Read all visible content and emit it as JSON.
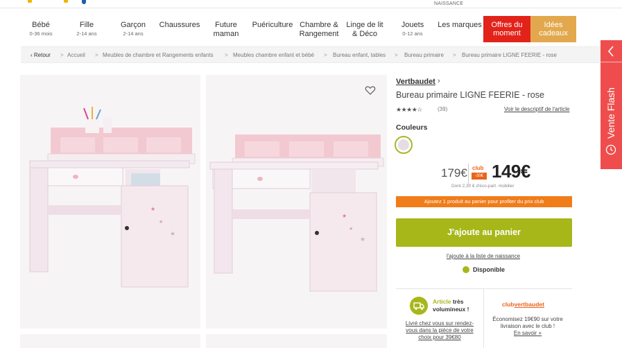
{
  "top": {
    "naissance_text": "NAISSANCE"
  },
  "nav": {
    "items": [
      {
        "label": "Bébé",
        "sub": "0-36 mois"
      },
      {
        "label": "Fille",
        "sub": "2-14 ans"
      },
      {
        "label": "Garçon",
        "sub": "2-14 ans"
      },
      {
        "label": "Chaussures",
        "sub": ""
      },
      {
        "label": "Future maman",
        "sub": ""
      },
      {
        "label": "Puériculture",
        "sub": ""
      },
      {
        "label": "Chambre & Rangement",
        "sub": ""
      },
      {
        "label": "Linge de lit & Déco",
        "sub": ""
      },
      {
        "label": "Jouets",
        "sub": "0-12 ans"
      },
      {
        "label": "Les marques",
        "sub": ""
      }
    ],
    "offres": "Offres du moment",
    "idees": "Idées cadeaux",
    "offres_color": "#e2231a",
    "idees_color": "#e3a84d"
  },
  "breadcrumb": {
    "back": "Retour",
    "items": [
      "Accueil",
      "Meubles de chambre et Rangements enfants",
      "Meubles chambre enfant et bébé",
      "Bureau enfant, tables",
      "Bureau primaire",
      "Bureau primaire LIGNE FEERIE - rose"
    ],
    "separator": ">"
  },
  "product": {
    "brand": "Vertbaudet",
    "title": "Bureau primaire LIGNE FEERIE - rose",
    "rating": 4.5,
    "stars": "★★★★☆",
    "review_count": "(39)",
    "descriptif_link": "Voir le descriptif de l'article",
    "couleurs_label": "Couleurs",
    "swatch_color": "#e5dde3",
    "old_price": "179€",
    "club_label": "club",
    "club_discount": "-30€",
    "club_price": "149€",
    "eco_part": "Dont 2,30 € d'éco-part. mobilier",
    "club_promo": "Ajoutez 1 produit au panier pour profiter du prix club",
    "add_to_cart": "J'ajoute au panier",
    "naissance_link": "l'ajoute à la liste de naissance",
    "availability": "Disponible",
    "accent_color": "#a7b71a",
    "orange_color": "#f07c1a"
  },
  "delivery": {
    "article_label_1": "Article",
    "article_label_2": "très volumineux !",
    "text": "Livré chez vous sur rendez-vous dans la pièce de votre choix pour 39€80"
  },
  "club_box": {
    "logo": "club",
    "logo_brand": "vertbaudet",
    "text": "Économisez 19€90 sur votre livraison avec le club !",
    "more_link": "En savoir +"
  },
  "side_tab": {
    "label": "Vente Flash",
    "color": "#ef4d4d"
  }
}
